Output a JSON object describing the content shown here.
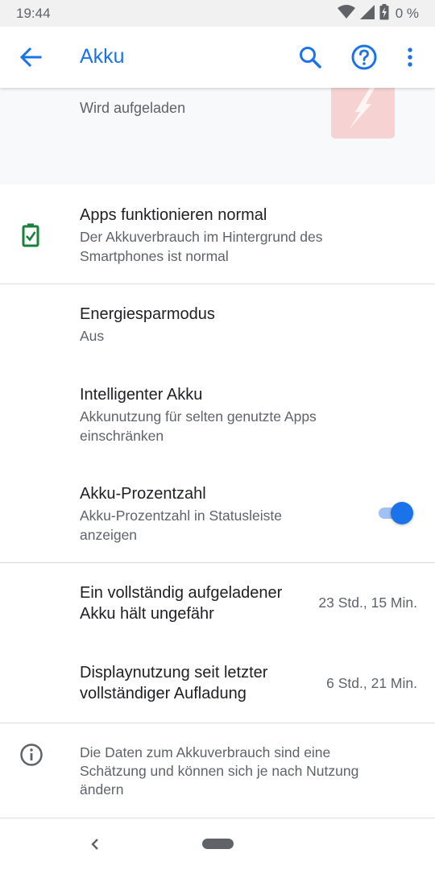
{
  "status_bar": {
    "time": "19:44",
    "battery_percent": "0 %",
    "icons": [
      "wifi-icon",
      "signal-icon",
      "battery-charging-icon"
    ]
  },
  "app_bar": {
    "title": "Akku",
    "icons": [
      "back-arrow-icon",
      "search-icon",
      "help-icon",
      "more-vert-icon"
    ]
  },
  "header": {
    "charging_text": "Wird aufgeladen"
  },
  "items": {
    "apps_status": {
      "title": "Apps funktionieren normal",
      "subtitle_line1": "Der Akkuverbrauch im Hintergrund des",
      "subtitle_line2": "Smartphones ist normal"
    },
    "energy_saver": {
      "title": "Energiesparmodus",
      "subtitle": "Aus"
    },
    "adaptive_battery": {
      "title": "Intelligenter Akku",
      "subtitle_line1": "Akkunutzung für selten genutzte Apps",
      "subtitle_line2": "einschränken"
    },
    "battery_percentage": {
      "title": "Akku-Prozentzahl",
      "subtitle_line1": "Akku-Prozentzahl in Statusleiste",
      "subtitle_line2": "anzeigen",
      "toggle_on": true
    },
    "full_charge_lasts": {
      "title_line1": "Ein vollständig aufgeladener",
      "title_line2": "Akku hält ungefähr",
      "value": "23 Std., 15 Min."
    },
    "screen_usage": {
      "title_line1": "Displaynutzung seit letzter",
      "title_line2": "vollständiger Aufladung",
      "value": "6 Std., 21 Min."
    }
  },
  "info": {
    "line1": "Die Daten zum Akkuverbrauch sind eine",
    "line2": "Schätzung und können sich je nach Nutzung",
    "line3": "ändern"
  },
  "colors": {
    "accent": "#1a73e8",
    "battery_ok": "#188038",
    "charging_graphic": "#f6d2d2"
  }
}
